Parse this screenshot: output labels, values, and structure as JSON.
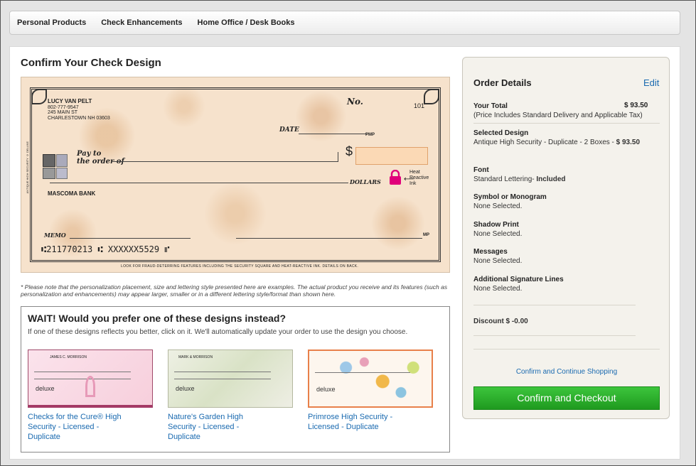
{
  "nav": {
    "items": [
      "Personal Products",
      "Check Enhancements",
      "Home Office / Desk Books"
    ]
  },
  "page": {
    "title": "Confirm Your Check Design",
    "disclaimer": "* Please note that the personalization placement, size and lettering style presented here are examples. The actual product you receive and its features (such as personalization and enhancements) may appear larger, smaller or in a different lettering style/format than shown here."
  },
  "check": {
    "name": "LUCY VAN PELT",
    "phone": "802-777-9547",
    "address1": "245 MAIN ST",
    "address2": "CHARLESTOWN NH 03603",
    "no_label": "No.",
    "number": "101",
    "date_label": "DATE",
    "pmp": "PMP",
    "pay_to_1": "Pay to",
    "pay_to_2": "the order of",
    "dollar_sign": "$",
    "dollars_label": "DOLLARS",
    "heat_label_1": "Heat",
    "heat_label_2": "Reactive",
    "heat_label_3": "Ink",
    "bank": "MASCOMA BANK",
    "memo_label": "MEMO",
    "mp": "MP",
    "micr": "⑆211770213 ⑆ XXXXXX5529 ⑈",
    "fraud_text": "LOOK FOR FRAUD-DETERRING FEATURES INCLUDING THE SECURITY SQUARE AND HEAT-REACTIVE INK. DETAILS ON BACK.",
    "side_text": "ANTIQUE HIGH SECURITY © DELUXE",
    "accent": "#e0007a",
    "paper": "#f6e2cc"
  },
  "suggest": {
    "title": "WAIT! Would you prefer one of these designs instead?",
    "subtitle": "If one of these designs reflects you better, click on it. We'll automatically update your order to use the design you choose.",
    "designs": [
      {
        "label": "Checks for the Cure® High Security - Licensed - Duplicate",
        "name": "JAMES C. MORRISON",
        "brand": "deluxe"
      },
      {
        "label": "Nature's Garden High Security - Licensed - Duplicate",
        "name": "MARK & MORRISON",
        "brand": "deluxe"
      },
      {
        "label": "Primrose High Security - Licensed - Duplicate",
        "name": "",
        "brand": "deluxe"
      }
    ]
  },
  "order": {
    "title": "Order Details",
    "edit": "Edit",
    "total_label": "Your Total",
    "total_amount": "$ 93.50",
    "total_note": "(Price Includes Standard Delivery and Applicable Tax)",
    "design_label": "Selected Design",
    "design_value": "Antique High Security - Duplicate - 2 Boxes - ",
    "design_price": "$ 93.50",
    "font_label": "Font",
    "font_value": "Standard Lettering- ",
    "font_included": "Included",
    "symbol_label": "Symbol or Monogram",
    "symbol_value": "None Selected.",
    "shadow_label": "Shadow Print",
    "shadow_value": "None Selected.",
    "messages_label": "Messages",
    "messages_value": "None Selected.",
    "sig_label": "Additional Signature Lines",
    "sig_value": "None Selected.",
    "discount": "Discount $ -0.00",
    "continue_link": "Confirm and Continue Shopping",
    "checkout_button": "Confirm and Checkout"
  }
}
